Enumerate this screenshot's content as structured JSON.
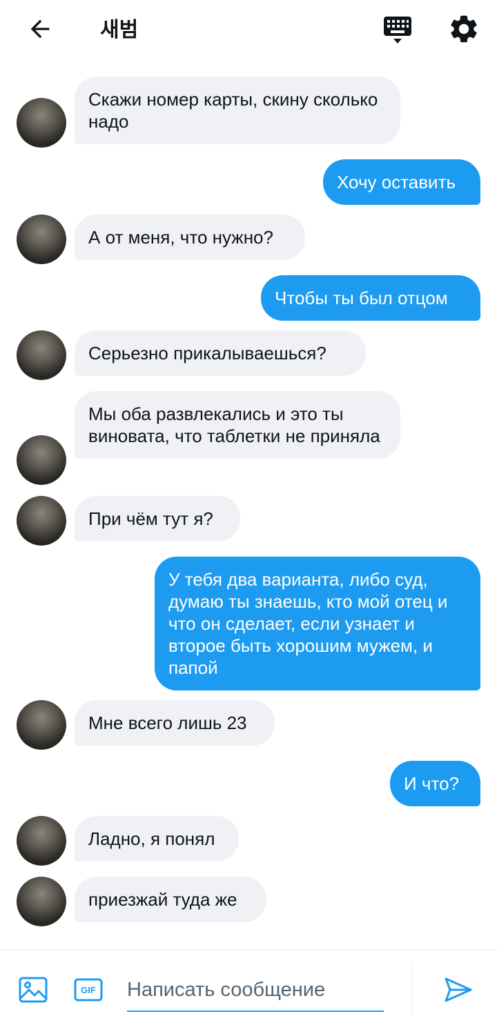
{
  "header": {
    "title": "새범",
    "icons": [
      "back-arrow-icon",
      "keyboard-icon",
      "gear-icon"
    ]
  },
  "colors": {
    "accent": "#1d9bf0",
    "incoming_bubble": "#eff1f5",
    "text": "#0f1419"
  },
  "messages": [
    {
      "direction": "in",
      "text": "Скажи номер карты, скину сколько надо"
    },
    {
      "direction": "out",
      "text": "Хочу оставить"
    },
    {
      "direction": "in",
      "text": "А от меня, что нужно?"
    },
    {
      "direction": "out",
      "text": "Чтобы ты был отцом"
    },
    {
      "direction": "in",
      "text": "Серьезно прикалываешься?"
    },
    {
      "direction": "in",
      "text": "Мы оба развлекались и это ты виновата, что таблетки не приняла"
    },
    {
      "direction": "in",
      "text": "При чём тут я?"
    },
    {
      "direction": "out",
      "text": "У тебя два варианта, либо суд, думаю ты знаешь, кто мой отец и что он сделает, если узнает и второе быть хорошим мужем, и папой"
    },
    {
      "direction": "in",
      "text": "Мне всего лишь 23"
    },
    {
      "direction": "out",
      "text": "И что?"
    },
    {
      "direction": "in",
      "text": "Ладно, я понял"
    },
    {
      "direction": "in",
      "text": "приезжай туда же"
    }
  ],
  "composer": {
    "placeholder": "Написать сообщение",
    "gif_label": "GIF",
    "icons": [
      "image-icon",
      "gif-icon",
      "send-icon"
    ]
  }
}
